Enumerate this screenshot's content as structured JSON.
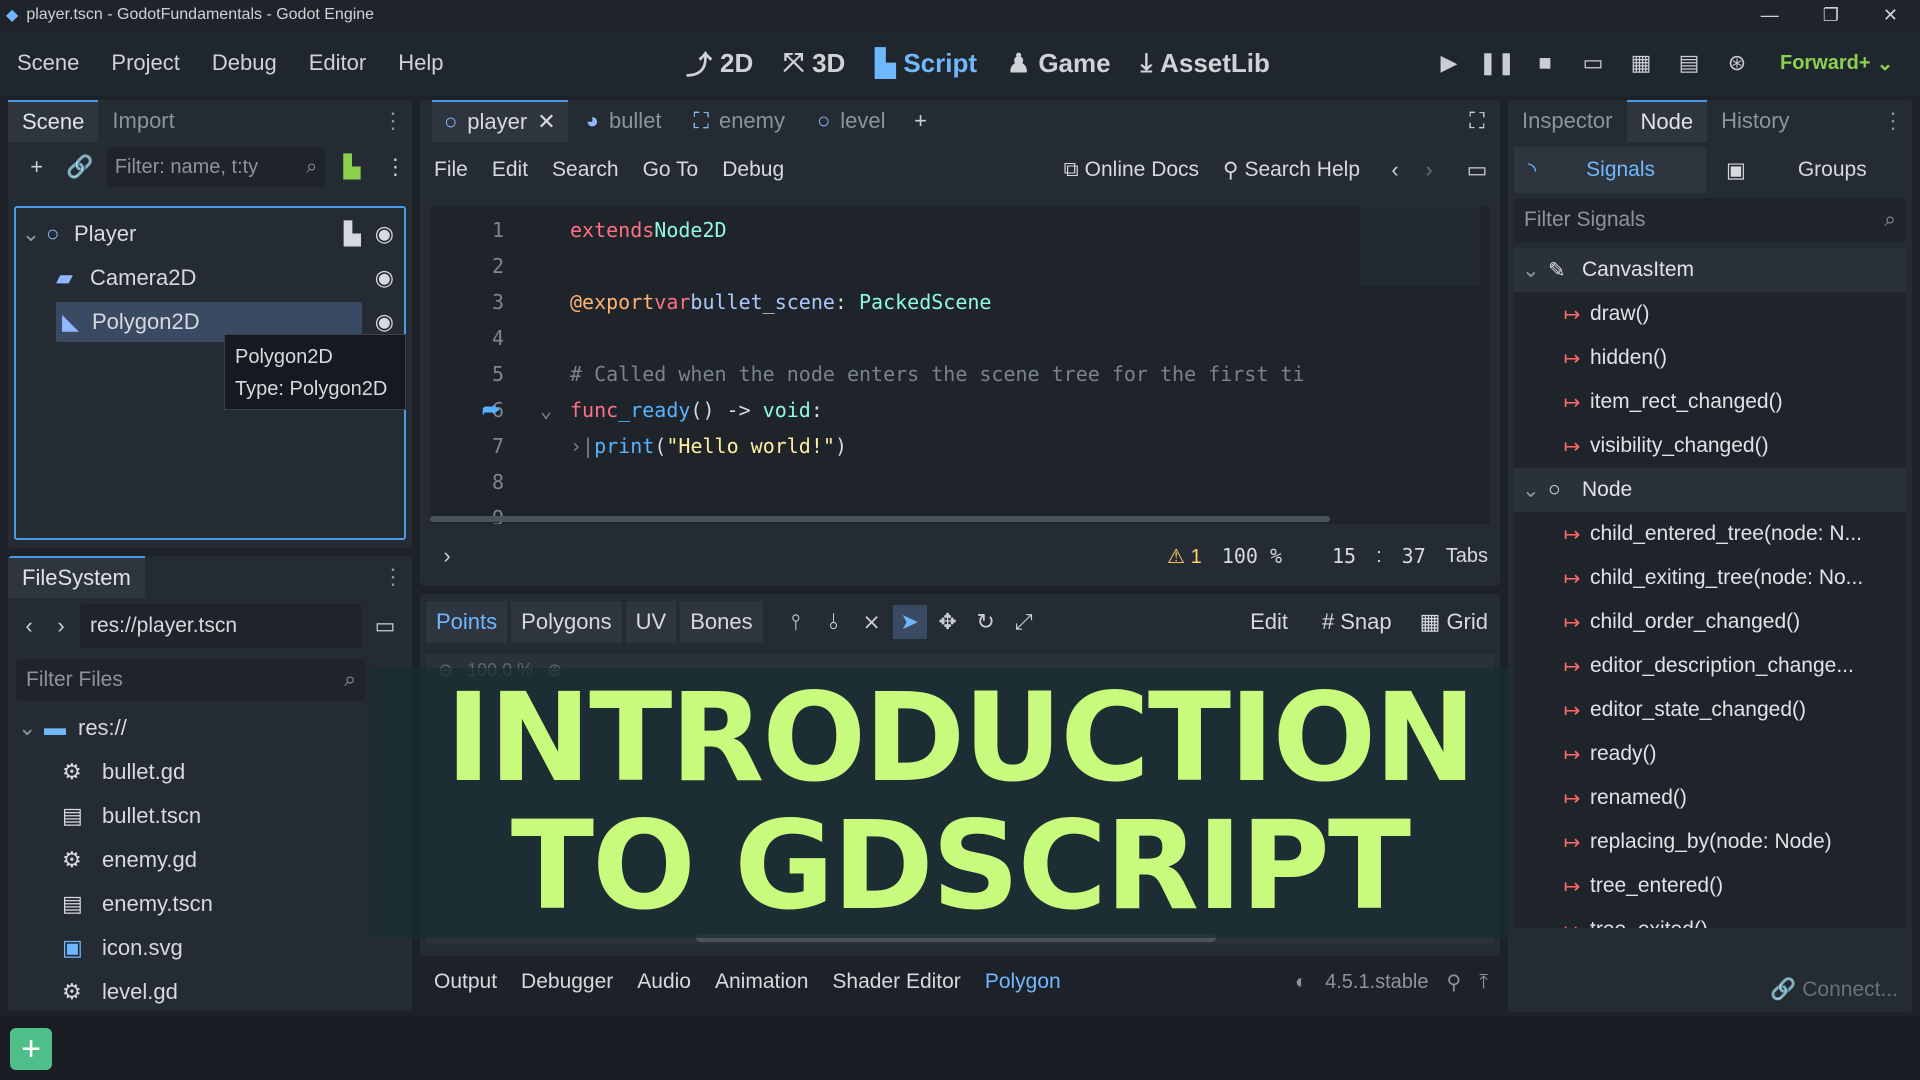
{
  "window": {
    "title": "player.tscn - GodotFundamentals - Godot Engine"
  },
  "menu": [
    "Scene",
    "Project",
    "Debug",
    "Editor",
    "Help"
  ],
  "modes": [
    {
      "icon": "2d-icon",
      "label": "2D"
    },
    {
      "icon": "3d-icon",
      "label": "3D"
    },
    {
      "icon": "script-icon",
      "label": "Script"
    },
    {
      "icon": "game-icon",
      "label": "Game"
    },
    {
      "icon": "assetlib-icon",
      "label": "AssetLib"
    }
  ],
  "renderer": "Forward+",
  "scene_dock": {
    "tabs": [
      "Scene",
      "Import"
    ],
    "filter_placeholder": "Filter: name, t:ty",
    "nodes": [
      {
        "label": "Player",
        "icon": "node2d-icon"
      },
      {
        "label": "Camera2D",
        "icon": "camera-icon"
      },
      {
        "label": "Polygon2D",
        "icon": "polygon-icon"
      }
    ],
    "tooltip": {
      "line1": "Polygon2D",
      "line2": "Type: Polygon2D"
    }
  },
  "filesystem": {
    "tab": "FileSystem",
    "path": "res://player.tscn",
    "filter_placeholder": "Filter Files",
    "root": "res://",
    "files": [
      {
        "name": "bullet.gd",
        "icon": "gear-icon"
      },
      {
        "name": "bullet.tscn",
        "icon": "scene-icon"
      },
      {
        "name": "enemy.gd",
        "icon": "gear-icon"
      },
      {
        "name": "enemy.tscn",
        "icon": "scene-icon"
      },
      {
        "name": "icon.svg",
        "icon": "image-icon"
      },
      {
        "name": "level.gd",
        "icon": "gear-icon"
      }
    ]
  },
  "editor": {
    "tabs": [
      "player",
      "bullet",
      "enemy",
      "level"
    ],
    "script_menu": [
      "File",
      "Edit",
      "Search",
      "Go To",
      "Debug"
    ],
    "online_docs": "Online Docs",
    "search_help": "Search Help",
    "status": {
      "warnings": "1",
      "zoom": "100 %",
      "line": "15",
      "sep": ":",
      "col": "37",
      "indent": "Tabs"
    }
  },
  "polygon_toolbar": {
    "tabs": [
      "Points",
      "Polygons",
      "UV",
      "Bones"
    ],
    "edit": "Edit",
    "snap": "Snap",
    "grid": "Grid",
    "zoom": "100.0 %"
  },
  "overlay": {
    "line1": "INTRODUCTION",
    "line2": "TO GDSCRIPT"
  },
  "bottom_tabs": [
    "Output",
    "Debugger",
    "Audio",
    "Animation",
    "Shader Editor",
    "Polygon"
  ],
  "version": "4.5.1.stable",
  "right_dock": {
    "tabs": [
      "Inspector",
      "Node",
      "History"
    ],
    "subtabs": {
      "signals": "Signals",
      "groups": "Groups"
    },
    "filter_placeholder": "Filter Signals",
    "groups": [
      {
        "name": "CanvasItem",
        "signals": [
          "draw()",
          "hidden()",
          "item_rect_changed()",
          "visibility_changed()"
        ]
      },
      {
        "name": "Node",
        "signals": [
          "child_entered_tree(node: N...",
          "child_exiting_tree(node: No...",
          "child_order_changed()",
          "editor_description_change...",
          "editor_state_changed()",
          "ready()",
          "renamed()",
          "replacing_by(node: Node)",
          "tree_entered()",
          "tree_exited()"
        ]
      }
    ],
    "connect": "Connect..."
  },
  "colors": {
    "accent": "#6fb8ff",
    "overlay_text": "#c8fa7d",
    "signal_icon": "#ff6b6b"
  }
}
